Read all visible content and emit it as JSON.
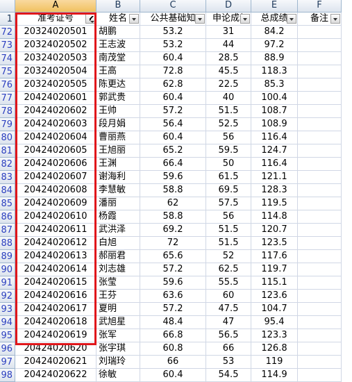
{
  "columns": [
    "A",
    "B",
    "C",
    "D",
    "E",
    "F"
  ],
  "header_row_number": "1",
  "headers": [
    "准考证号",
    "姓名",
    "公共基础知",
    "申论成绩",
    "总成绩",
    "备注"
  ],
  "rows": [
    {
      "n": "72",
      "id": "20324020501",
      "name": "胡鹏",
      "c": "53.2",
      "d": "31",
      "e": "84.2"
    },
    {
      "n": "73",
      "id": "20324020502",
      "name": "王志波",
      "c": "53.2",
      "d": "44",
      "e": "97.2"
    },
    {
      "n": "74",
      "id": "20324020503",
      "name": "南茂堂",
      "c": "60.4",
      "d": "28.5",
      "e": "88.9"
    },
    {
      "n": "75",
      "id": "20324020504",
      "name": "王高",
      "c": "72.8",
      "d": "45.5",
      "e": "118.3"
    },
    {
      "n": "76",
      "id": "20324020505",
      "name": "陈更达",
      "c": "62.8",
      "d": "22.5",
      "e": "85.3"
    },
    {
      "n": "77",
      "id": "20424020601",
      "name": "郭武贵",
      "c": "60.4",
      "d": "40",
      "e": "100.4"
    },
    {
      "n": "78",
      "id": "20424020602",
      "name": "王帅",
      "c": "57.2",
      "d": "51.5",
      "e": "108.7"
    },
    {
      "n": "79",
      "id": "20424020603",
      "name": "段月娟",
      "c": "56.4",
      "d": "52.5",
      "e": "108.9"
    },
    {
      "n": "80",
      "id": "20424020604",
      "name": "曹丽燕",
      "c": "60.4",
      "d": "56",
      "e": "116.4"
    },
    {
      "n": "81",
      "id": "20424020605",
      "name": "王旭丽",
      "c": "65.2",
      "d": "59.5",
      "e": "124.7"
    },
    {
      "n": "82",
      "id": "20424020606",
      "name": "王渊",
      "c": "66.4",
      "d": "50",
      "e": "116.4"
    },
    {
      "n": "83",
      "id": "20424020607",
      "name": "谢海利",
      "c": "59.6",
      "d": "61.5",
      "e": "121.1"
    },
    {
      "n": "84",
      "id": "20424020608",
      "name": "李慧敏",
      "c": "58.8",
      "d": "69.5",
      "e": "128.3"
    },
    {
      "n": "85",
      "id": "20424020609",
      "name": "潘丽",
      "c": "62",
      "d": "57.5",
      "e": "119.5"
    },
    {
      "n": "86",
      "id": "20424020610",
      "name": "杨霞",
      "c": "58.8",
      "d": "56",
      "e": "114.8"
    },
    {
      "n": "87",
      "id": "20424020611",
      "name": "武洪泽",
      "c": "69.2",
      "d": "51.5",
      "e": "120.7"
    },
    {
      "n": "88",
      "id": "20424020612",
      "name": "白旭",
      "c": "72",
      "d": "51.5",
      "e": "123.5"
    },
    {
      "n": "89",
      "id": "20424020613",
      "name": "郝丽君",
      "c": "65.6",
      "d": "52",
      "e": "117.6"
    },
    {
      "n": "90",
      "id": "20424020614",
      "name": "刘志雄",
      "c": "57.2",
      "d": "62.5",
      "e": "119.7"
    },
    {
      "n": "91",
      "id": "20424020615",
      "name": "张莹",
      "c": "59.6",
      "d": "55.5",
      "e": "115.1"
    },
    {
      "n": "92",
      "id": "20424020616",
      "name": "王芬",
      "c": "63.6",
      "d": "60",
      "e": "123.6"
    },
    {
      "n": "93",
      "id": "20424020617",
      "name": "夏明",
      "c": "57.2",
      "d": "47.5",
      "e": "104.7"
    },
    {
      "n": "94",
      "id": "20424020618",
      "name": "武旭星",
      "c": "48.4",
      "d": "47",
      "e": "95.4"
    },
    {
      "n": "95",
      "id": "20424020619",
      "name": "张军",
      "c": "66.8",
      "d": "56.5",
      "e": "123.3"
    },
    {
      "n": "96",
      "id": "20424020620",
      "name": "张宇琪",
      "c": "60.8",
      "d": "66",
      "e": "126.8"
    },
    {
      "n": "97",
      "id": "20424020621",
      "name": "刘瑞玲",
      "c": "66",
      "d": "53",
      "e": "119"
    },
    {
      "n": "98",
      "id": "20424020622",
      "name": "徐敏",
      "c": "60.4",
      "d": "54.5",
      "e": "114.9"
    }
  ],
  "colors": {
    "highlight_border": "#e0161b",
    "row_number_filtered": "#2b3fbf",
    "gridline": "#d0d7e5"
  }
}
